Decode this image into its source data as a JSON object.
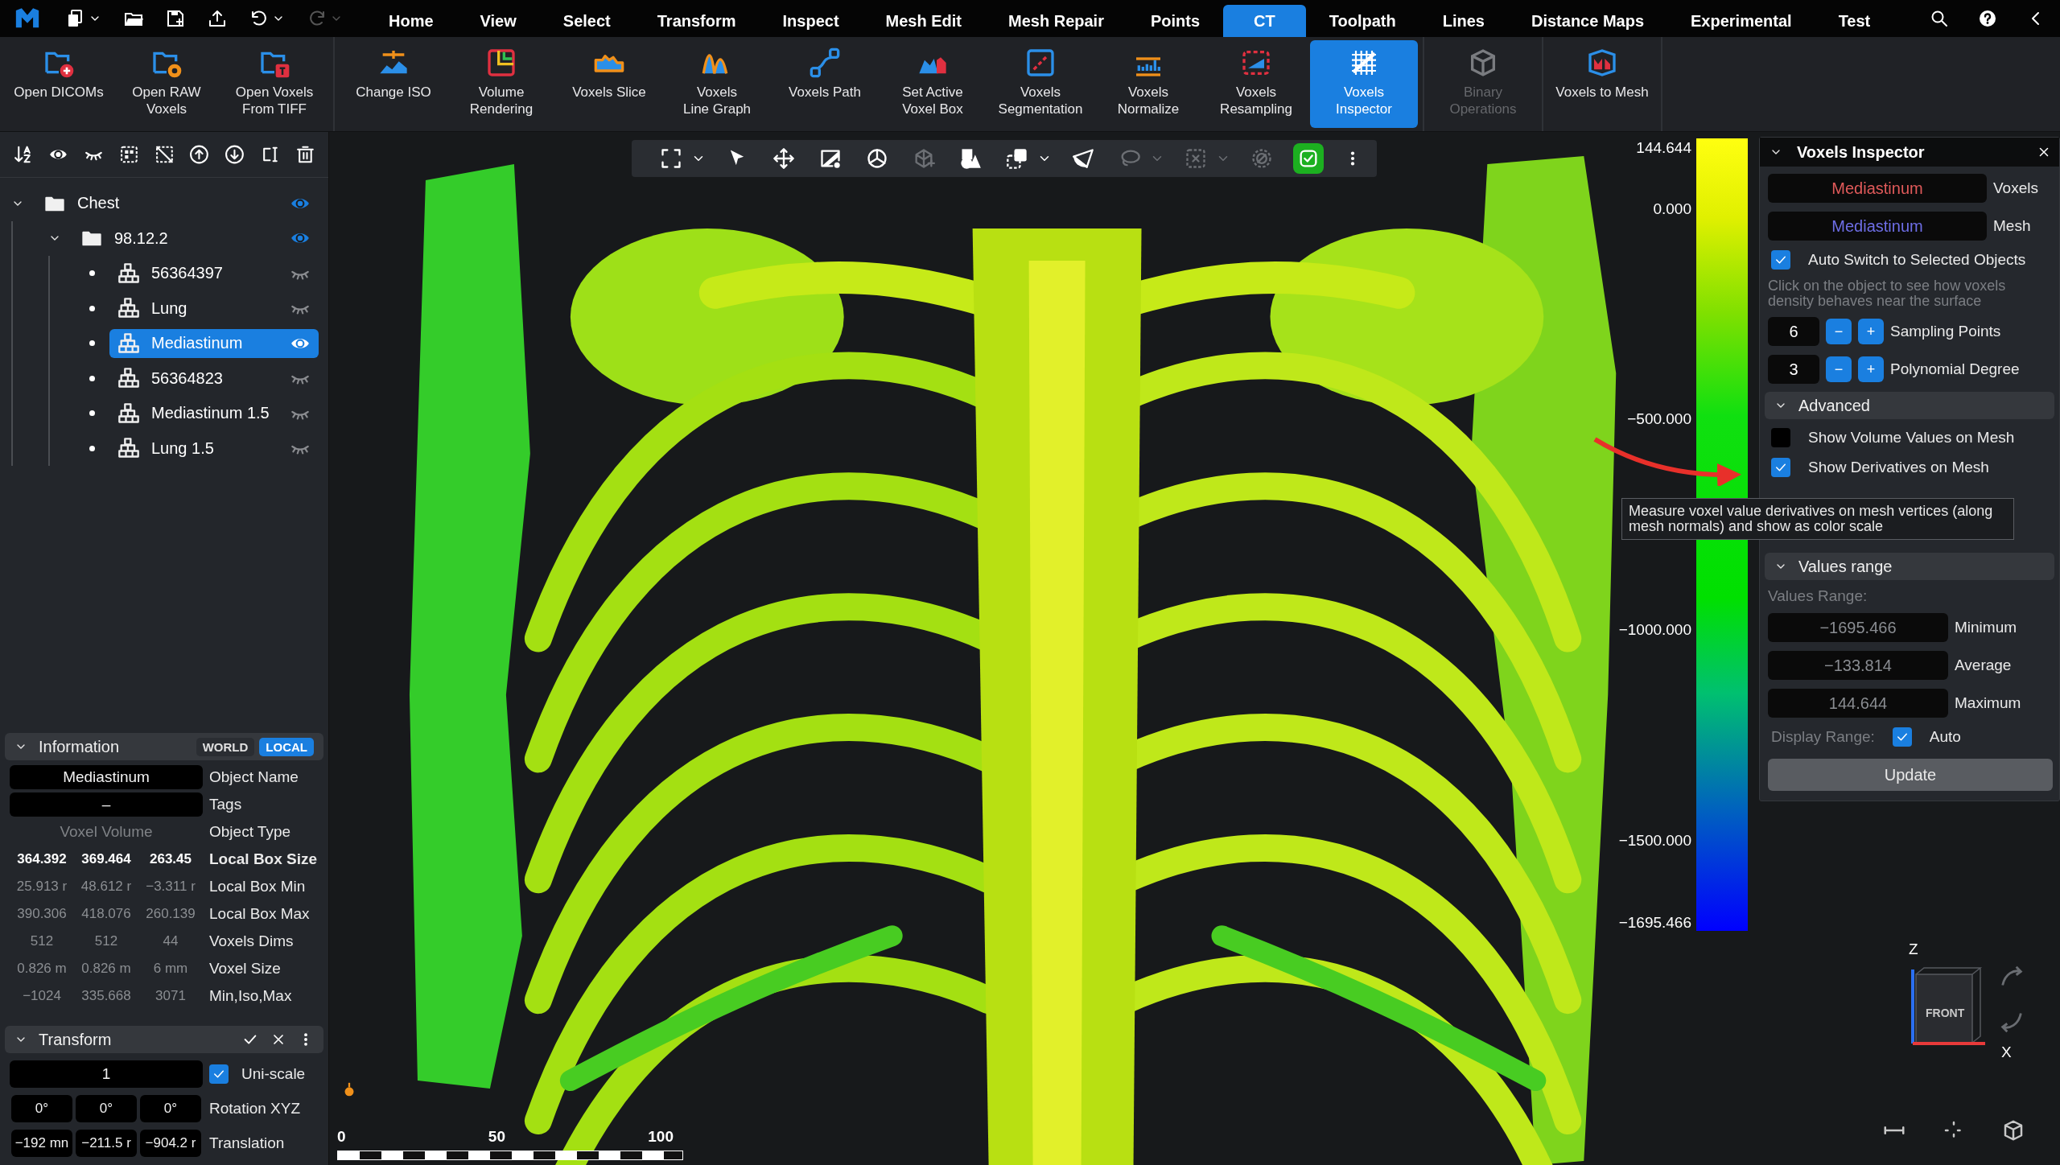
{
  "menu_tabs": [
    {
      "label": "Home",
      "selected": false
    },
    {
      "label": "View",
      "selected": false
    },
    {
      "label": "Select",
      "selected": false
    },
    {
      "label": "Transform",
      "selected": false
    },
    {
      "label": "Inspect",
      "selected": false
    },
    {
      "label": "Mesh Edit",
      "selected": false
    },
    {
      "label": "Mesh Repair",
      "selected": false
    },
    {
      "label": "Points",
      "selected": false
    },
    {
      "label": "CT",
      "selected": true
    },
    {
      "label": "Toolpath",
      "selected": false
    },
    {
      "label": "Lines",
      "selected": false
    },
    {
      "label": "Distance Maps",
      "selected": false
    },
    {
      "label": "Experimental",
      "selected": false
    },
    {
      "label": "Test",
      "selected": false
    }
  ],
  "ribbon_groups": [
    [
      {
        "label": "Open DICOMs",
        "selected": false,
        "disabled": false
      },
      {
        "label": "Open RAW\nVoxels",
        "selected": false,
        "disabled": false
      },
      {
        "label": "Open Voxels\nFrom TIFF",
        "selected": false,
        "disabled": false
      }
    ],
    [
      {
        "label": "Change ISO",
        "selected": false,
        "disabled": false
      },
      {
        "label": "Volume\nRendering",
        "selected": false,
        "disabled": false
      },
      {
        "label": "Voxels Slice",
        "selected": false,
        "disabled": false
      },
      {
        "label": "Voxels\nLine Graph",
        "selected": false,
        "disabled": false
      },
      {
        "label": "Voxels Path",
        "selected": false,
        "disabled": false
      },
      {
        "label": "Set Active\nVoxel Box",
        "selected": false,
        "disabled": false
      },
      {
        "label": "Voxels\nSegmentation",
        "selected": false,
        "disabled": false
      },
      {
        "label": "Voxels\nNormalize",
        "selected": false,
        "disabled": false
      },
      {
        "label": "Voxels\nResampling",
        "selected": false,
        "disabled": false
      },
      {
        "label": "Voxels\nInspector",
        "selected": true,
        "disabled": false
      }
    ],
    [
      {
        "label": "Binary\nOperations",
        "selected": false,
        "disabled": true
      }
    ],
    [
      {
        "label": "Voxels to Mesh",
        "selected": false,
        "disabled": false
      }
    ]
  ],
  "tree": [
    {
      "label": "Chest",
      "kind": "folder",
      "expanded": true,
      "visible": true,
      "selected": false,
      "children": [
        {
          "label": "98.12.2",
          "kind": "folder",
          "expanded": true,
          "visible": true,
          "selected": false,
          "children": [
            {
              "label": "56364397",
              "kind": "object",
              "visible": false,
              "selected": false
            },
            {
              "label": "Lung",
              "kind": "object",
              "visible": false,
              "selected": false
            },
            {
              "label": "Mediastinum",
              "kind": "object",
              "visible": true,
              "selected": true
            },
            {
              "label": "56364823",
              "kind": "object",
              "visible": false,
              "selected": false
            },
            {
              "label": "Mediastinum 1.5",
              "kind": "object",
              "visible": false,
              "selected": false
            },
            {
              "label": "Lung 1.5",
              "kind": "object",
              "visible": false,
              "selected": false
            }
          ]
        }
      ]
    }
  ],
  "information": {
    "title": "Information",
    "expanded": true,
    "modes": [
      {
        "label": "WORLD",
        "selected": false
      },
      {
        "label": "LOCAL",
        "selected": true
      }
    ],
    "rows": [
      {
        "kind": "field",
        "values": [
          "Mediastinum"
        ],
        "label": "Object Name"
      },
      {
        "kind": "field",
        "values": [
          "–"
        ],
        "label": "Tags"
      },
      {
        "kind": "plain",
        "values": [
          "Voxel Volume"
        ],
        "label": "Object Type"
      },
      {
        "kind": "strong",
        "values": [
          "364.392",
          "369.464",
          "263.45"
        ],
        "label": "Local Box Size"
      },
      {
        "kind": "muted",
        "values": [
          "25.913 r",
          "48.612 r",
          "−3.311 r"
        ],
        "label": "Local Box Min"
      },
      {
        "kind": "muted",
        "values": [
          "390.306",
          "418.076",
          "260.139"
        ],
        "label": "Local Box Max"
      },
      {
        "kind": "muted",
        "values": [
          "512",
          "512",
          "44"
        ],
        "label": "Voxels Dims"
      },
      {
        "kind": "muted",
        "values": [
          "0.826 m",
          "0.826 m",
          "6 mm"
        ],
        "label": "Voxel Size"
      },
      {
        "kind": "muted",
        "values": [
          "−1024",
          "335.668",
          "3071"
        ],
        "label": "Min,Iso,Max"
      }
    ]
  },
  "transform": {
    "title": "Transform",
    "expanded": true,
    "scale": "1",
    "uniscale": {
      "label": "Uni-scale",
      "checked": true
    },
    "rows": [
      {
        "values": [
          "0°",
          "0°",
          "0°"
        ],
        "label": "Rotation XYZ"
      },
      {
        "values": [
          "−192 mn",
          "−211.5 r",
          "−904.2 r"
        ],
        "label": "Translation"
      }
    ]
  },
  "viewport_tools": [
    {
      "dropdown": true,
      "disabled": false,
      "on": false
    },
    {
      "dropdown": false,
      "disabled": false,
      "on": false
    },
    {
      "dropdown": false,
      "disabled": false,
      "on": false
    },
    {
      "dropdown": false,
      "disabled": false,
      "on": false
    },
    {
      "dropdown": false,
      "disabled": false,
      "on": false
    },
    {
      "dropdown": false,
      "disabled": true,
      "on": false
    },
    {
      "dropdown": false,
      "disabled": false,
      "on": false
    },
    {
      "dropdown": true,
      "disabled": false,
      "on": false
    },
    {
      "dropdown": false,
      "disabled": false,
      "on": false
    },
    {
      "dropdown": true,
      "disabled": true,
      "on": false
    },
    {
      "dropdown": true,
      "disabled": true,
      "on": false
    },
    {
      "dropdown": false,
      "disabled": true,
      "on": false
    },
    {
      "dropdown": false,
      "disabled": false,
      "on": true
    }
  ],
  "color_scale": {
    "labels": [
      "144.644",
      "0.000",
      "−500.000",
      "−1000.000",
      "−1500.000",
      "−1695.466"
    ]
  },
  "scale_bar": {
    "labels": [
      "0",
      "50",
      "100"
    ]
  },
  "axes": {
    "z": "Z",
    "x": "X",
    "face": "FRONT"
  },
  "inspector": {
    "title": "Voxels Inspector",
    "sources": [
      {
        "value": "Mediastinum",
        "label": "Voxels",
        "color": "#e05a5a"
      },
      {
        "value": "Mediastinum",
        "label": "Mesh",
        "color": "#6e6ee6"
      }
    ],
    "auto_switch": {
      "label": "Auto Switch to Selected Objects",
      "checked": true
    },
    "hint": "Click on the object to see how voxels density behaves near the surface",
    "steppers": [
      {
        "value": "6",
        "label": "Sampling Points",
        "minus": "−",
        "plus": "+"
      },
      {
        "value": "3",
        "label": "Polynomial Degree",
        "minus": "−",
        "plus": "+"
      }
    ],
    "advanced": {
      "title": "Advanced",
      "expanded": true,
      "options": [
        {
          "label": "Show Volume Values on Mesh",
          "checked": false
        },
        {
          "label": "Show Derivatives on Mesh",
          "checked": true
        }
      ]
    },
    "values_range": {
      "title": "Values range",
      "expanded": true,
      "caption": "Values Range:",
      "rows": [
        {
          "value": "−1695.466",
          "label": "Minimum"
        },
        {
          "value": "−133.814",
          "label": "Average"
        },
        {
          "value": "144.644",
          "label": "Maximum"
        }
      ],
      "display_range": {
        "label": "Display Range:",
        "auto": {
          "label": "Auto",
          "checked": true
        }
      },
      "button": "Update"
    }
  },
  "tooltip": {
    "text": "Measure voxel value derivatives on mesh vertices (along mesh normals) and show as color scale"
  }
}
